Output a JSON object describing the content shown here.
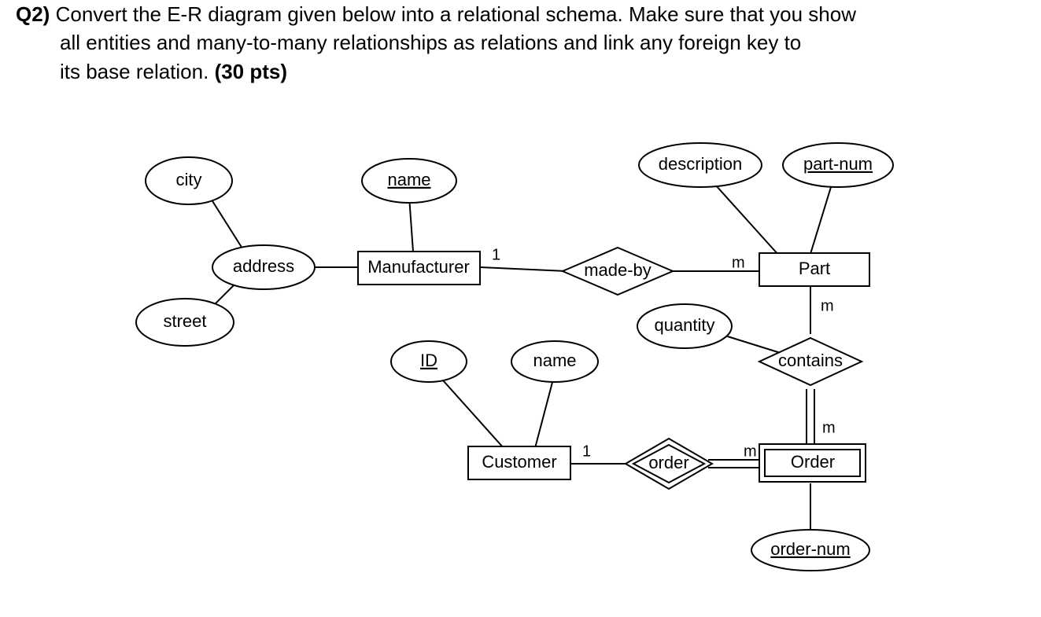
{
  "question": {
    "label": "Q2)",
    "line1": "Convert the E-R diagram given below into a relational schema. Make sure that you show",
    "line2": "all entities and many-to-many relationships as relations and link any foreign key to",
    "line3": "its base relation.",
    "points": "(30 pts)"
  },
  "diagram": {
    "attributes": {
      "city": "city",
      "street": "street",
      "address": "address",
      "mfr_name": "name",
      "description": "description",
      "part_num": "part-num",
      "cust_id": "ID",
      "cust_name": "name",
      "quantity": "quantity",
      "order_num": "order-num"
    },
    "entities": {
      "manufacturer": "Manufacturer",
      "part": "Part",
      "customer": "Customer",
      "order": "Order"
    },
    "relationships": {
      "made_by": "made-by",
      "contains": "contains",
      "order_rel": "order"
    },
    "cardinalities": {
      "mfr_made": "1",
      "part_made": "m",
      "part_contains": "m",
      "order_contains": "m",
      "cust_order": "1",
      "order_order": "m"
    }
  }
}
